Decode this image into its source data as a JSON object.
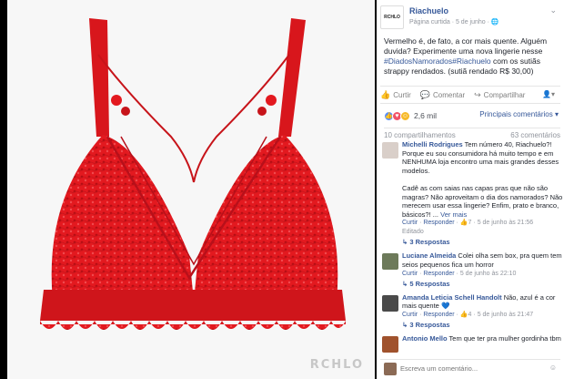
{
  "photo": {
    "watermark": "RCHLO",
    "product_color": "#e3191f"
  },
  "post": {
    "page_logo": "RCHLO",
    "page_name": "Riachuelo",
    "subtitle": "Página curtida · 5 de junho · ",
    "menu": "⌄",
    "text_before_link": "Vermelho é, de fato, a cor mais quente. Alguém duvida? Experimente uma nova lingerie nesse ",
    "hashtag": "#DiadosNamorados",
    "hashtag2": "#Riachuelo",
    "text_after_link": " com os sutiãs strappy rendados. (sutiã rendado R$ 30,00)"
  },
  "actions": {
    "like": "Curtir",
    "comment": "Comentar",
    "share": "Compartilhar",
    "avatar_menu": "▾"
  },
  "reactions": {
    "count": "2,6 mil",
    "top_comments": "Principais comentários ▾",
    "shares": "10 compartilhamentos",
    "comments_count": "63 comentários"
  },
  "comments": [
    {
      "author": "Michelli Rodrigues",
      "text": " Tem número 40, Riachuelo?! Porque eu sou consumidora há muito tempo e em NENHUMA loja encontro uma mais grandes desses modelos.\n\nCadê as com saias nas capas pras que não são magras? Não aproveitam o dia dos namorados? Não merecem usar essa lingerie? Enfim, prato e branco, básicos?! ...",
      "more": "Ver mais",
      "like": "Curtir",
      "reply": "Responder",
      "likes": "7",
      "date": "5 de junho às 21:56",
      "edited": "Editado",
      "replies": "↳ 3 Respostas",
      "avatar_color": "#d9cfc9"
    },
    {
      "author": "Luciane Almeida",
      "text": " Colei olha sem box, pra quem tem seios pequenos fica um horror",
      "like": "Curtir",
      "reply": "Responder",
      "date": "5 de junho às 22:10",
      "replies": "↳ 5 Respostas",
      "avatar_color": "#6d7a5a"
    },
    {
      "author": "Amanda Leticia Schell Handolt",
      "text": " Não, azul é a cor mais quente 💙",
      "like": "Curtir",
      "reply": "Responder",
      "likes": "4",
      "date": "5 de junho às 21:47",
      "replies": "↳ 3 Respostas",
      "avatar_color": "#4a4a4a"
    },
    {
      "author": "Antonio Mello",
      "text": " Tem que ter pra mulher gordinha tbm",
      "avatar_color": "#a0522d"
    }
  ],
  "write": {
    "placeholder": "Escreva um comentário...",
    "icon": "☺"
  }
}
